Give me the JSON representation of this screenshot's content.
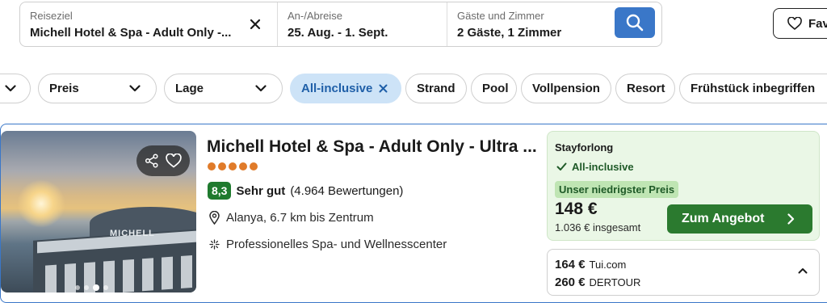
{
  "search": {
    "destination_label": "Reiseziel",
    "destination_value": "Michell Hotel & Spa - Adult Only -...",
    "dates_label": "An-/Abreise",
    "dates_value": "25. Aug. - 1. Sept.",
    "guests_label": "Gäste und Zimmer",
    "guests_value": "2 Gäste, 1 Zimmer",
    "accent_color": "#3a77c8"
  },
  "favorites_label": "Fav",
  "filters": [
    {
      "label": ""
    },
    {
      "label": "Preis"
    },
    {
      "label": "Lage"
    },
    {
      "label": "All-inclusive",
      "active": true
    },
    {
      "label": "Strand"
    },
    {
      "label": "Pool"
    },
    {
      "label": "Vollpension"
    },
    {
      "label": "Resort"
    },
    {
      "label": "Frühstück inbegriffen"
    }
  ],
  "hotel": {
    "photo_sign": "MICHELL",
    "photo_index": 3,
    "photo_count": 4,
    "name": "Michell Hotel & Spa - Adult Only - Ultra ...",
    "stars": 5,
    "rating_score": "8,3",
    "rating_word": "Sehr gut",
    "rating_count": "(4.964 Bewertungen)",
    "location": "Alanya, 6.7 km bis Zentrum",
    "feature": "Professionelles Spa- und Wellnesscenter"
  },
  "deal": {
    "provider": "Stayforlong",
    "board": "All-inclusive",
    "badge": "Unser niedrigster Preis",
    "price": "148 €",
    "total": "1.036 € insgesamt",
    "cta": "Zum Angebot",
    "cta_color": "#2b7a2f"
  },
  "other_offers": [
    {
      "price": "164 €",
      "provider": "Tui.com"
    },
    {
      "price": "260 €",
      "provider": "DERTOUR"
    }
  ]
}
